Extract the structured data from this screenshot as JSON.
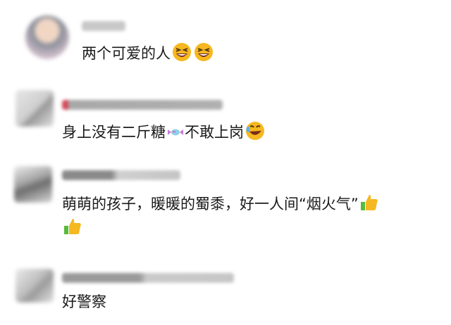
{
  "comments": [
    {
      "avatar_shape": "round",
      "text": "两个可爱的人",
      "emojis": [
        "laughing-face-icon",
        "laughing-face-icon"
      ]
    },
    {
      "avatar_shape": "square",
      "text_before": "身上没有二斤糖",
      "text_after": "不敢上岗",
      "emojis": [
        "candy-icon",
        "rolling-laugh-icon"
      ]
    },
    {
      "avatar_shape": "square",
      "line1": "萌萌的孩子，暖暖的蜀黍，好一人间“烟火气”",
      "emojis": [
        "thumbs-up-icon",
        "thumbs-up-icon"
      ]
    },
    {
      "avatar_shape": "square",
      "text": "好警察"
    }
  ],
  "colors": {
    "text": "#1a1a1a",
    "blur": "#b8b8b8",
    "emoji_yellow": "#f5b820",
    "thumb_green": "#5ab93b"
  }
}
